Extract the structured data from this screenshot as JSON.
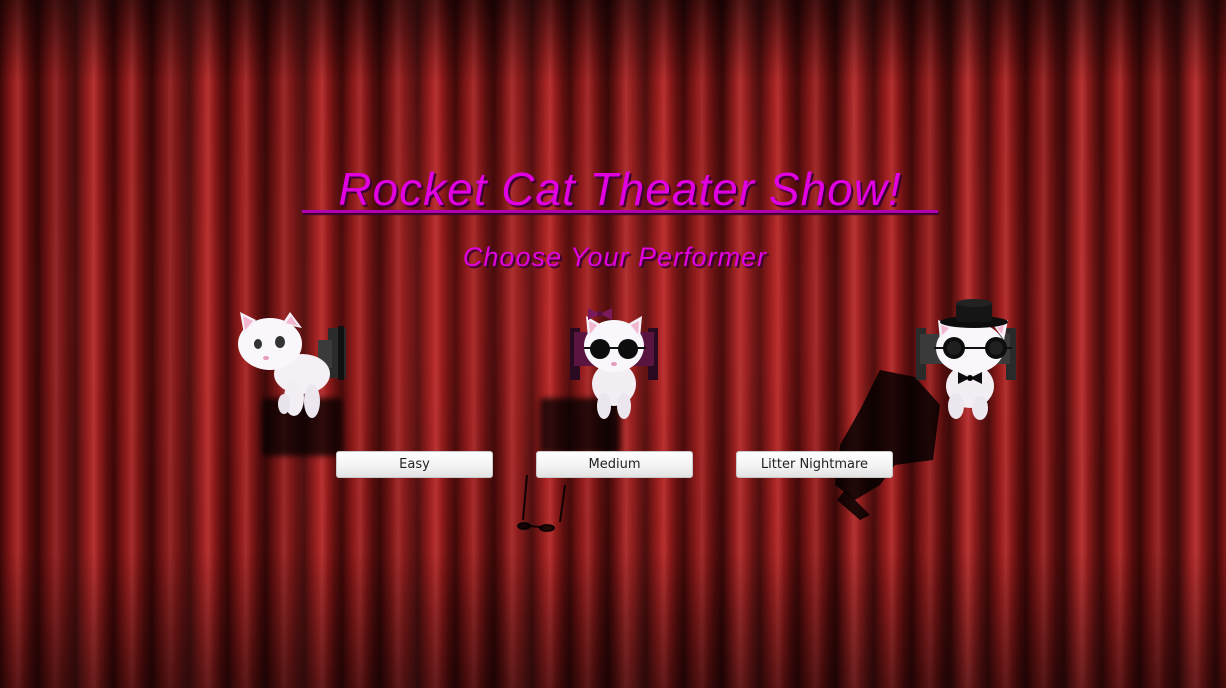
{
  "game": {
    "title": "Rocket Cat Theater Show!",
    "subtitle": "Choose Your Performer"
  },
  "performers": [
    {
      "label": "Easy"
    },
    {
      "label": "Medium"
    },
    {
      "label": "Litter Nightmare"
    }
  ],
  "colors": {
    "title": "#e000e0",
    "curtain": "#8a1818",
    "button_bg": "#f2f2f2",
    "button_text": "#222222"
  },
  "icons": [
    "white-cat-icon",
    "cat-with-bow-and-sunglasses-icon",
    "cat-with-top-hat-sunglasses-and-bowtie-icon"
  ]
}
